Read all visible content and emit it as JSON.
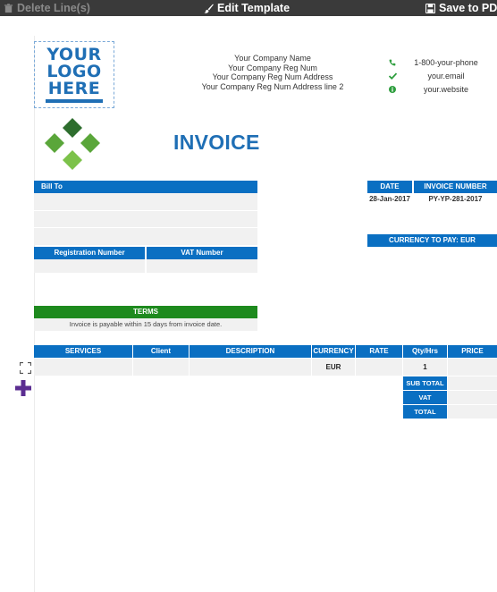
{
  "toolbar": {
    "delete_label": "Delete Line(s)",
    "edit_label": "Edit Template",
    "pdf_label": "Save to PDF",
    "icons": [
      "trash-icon",
      "brush-icon",
      "floppy-icon"
    ]
  },
  "logo": {
    "lines": [
      "YOUR",
      "LOGO",
      "HERE"
    ],
    "color": "#1f6fb5"
  },
  "company": {
    "name": "Your Company Name",
    "reg_num": "Your Company Reg Num",
    "address": "Your Company Reg Num Address",
    "address2": "Your Company Reg Num Address line 2"
  },
  "contact": {
    "phone": "1-800-your-phone",
    "email": "your.email",
    "website": "your.website"
  },
  "invoice": {
    "title": "INVOICE",
    "bill_to_label": "Bill To",
    "registration_label": "Registration Number",
    "vat_label": "VAT Number",
    "terms_label": "TERMS",
    "terms_text": "Invoice is payable within 15 days from invoice date.",
    "date_label": "DATE",
    "date_value": "28-Jan-2017",
    "invoice_number_label": "INVOICE NUMBER",
    "invoice_number_value": "PY-YP-281-2017",
    "currency_label": "CURRENCY TO PAY: EUR"
  },
  "table": {
    "headers": [
      "SERVICES",
      "Client",
      "DESCRIPTION",
      "CURRENCY",
      "RATE",
      "Qty/Hrs",
      "PRICE"
    ],
    "rows": [
      {
        "currency": "EUR",
        "qty": "1"
      }
    ],
    "subtotal_label": "SUB TOTAL",
    "vat_label": "VAT",
    "total_label": "TOTAL"
  },
  "colors": {
    "accent_blue": "#0a6fc2",
    "terms_green": "#1e8a1e",
    "logo_blue": "#1f6fb5",
    "add_purple": "#5b2d91"
  }
}
